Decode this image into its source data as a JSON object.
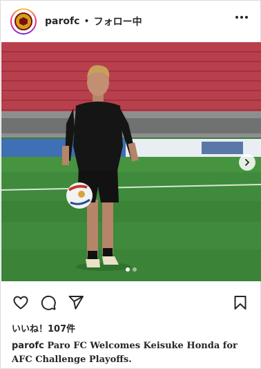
{
  "header": {
    "username": "parofc",
    "separator": "•",
    "follow_status": "フォロー中"
  },
  "carousel": {
    "current_index": 1,
    "total": 2
  },
  "stats": {
    "likes": "いいね！107件"
  },
  "caption": {
    "username": "parofc",
    "text": "Paro FC Welcomes Keisuke Honda for AFC Challenge Playoffs."
  },
  "colors": {
    "text": "#262626",
    "border": "#dbdbdb",
    "pitch": "#3f8a3c",
    "stands": "#b8404c"
  },
  "icons": [
    "heart-icon",
    "comment-icon",
    "share-icon",
    "bookmark-icon",
    "more-icon",
    "chevron-right-icon"
  ]
}
